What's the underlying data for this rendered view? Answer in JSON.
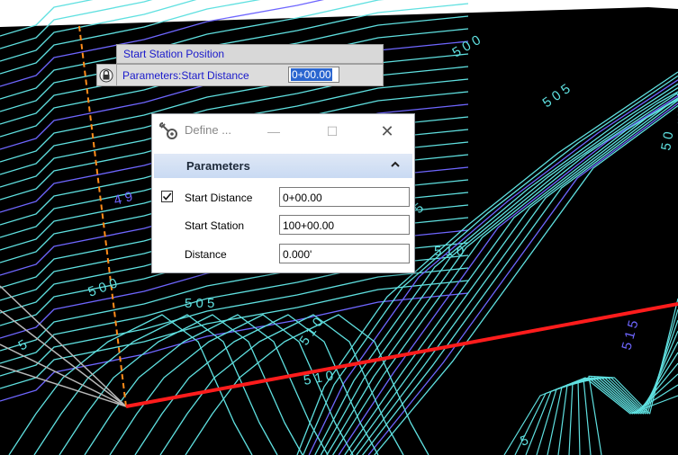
{
  "prompt": {
    "title": "Start Station Position",
    "param_label": "Parameters:Start Distance",
    "param_value": "0+00.00"
  },
  "dialog": {
    "title": "Define ...",
    "section_title": "Parameters",
    "fields": [
      {
        "label": "Start Distance",
        "value": "0+00.00",
        "checked": true
      },
      {
        "label": "Start Station",
        "value": "100+00.00"
      },
      {
        "label": "Distance",
        "value": "0.000'"
      }
    ]
  },
  "contour_labels": [
    "5 0 0",
    "5 0 5",
    "5 1 0",
    "4 9",
    "5 0 0",
    "5 0 5",
    "5 1 0",
    "5 1 0",
    "5 1 5",
    "5 0",
    "5",
    "5",
    "5"
  ],
  "colors": {
    "background": "#000000",
    "minor_contour": "#5fe0e0",
    "major_contour": "#6e66ff",
    "alignment": "#ff1c1c",
    "construction_line": "#ff8c1a",
    "highlight": "#2b66d0"
  }
}
